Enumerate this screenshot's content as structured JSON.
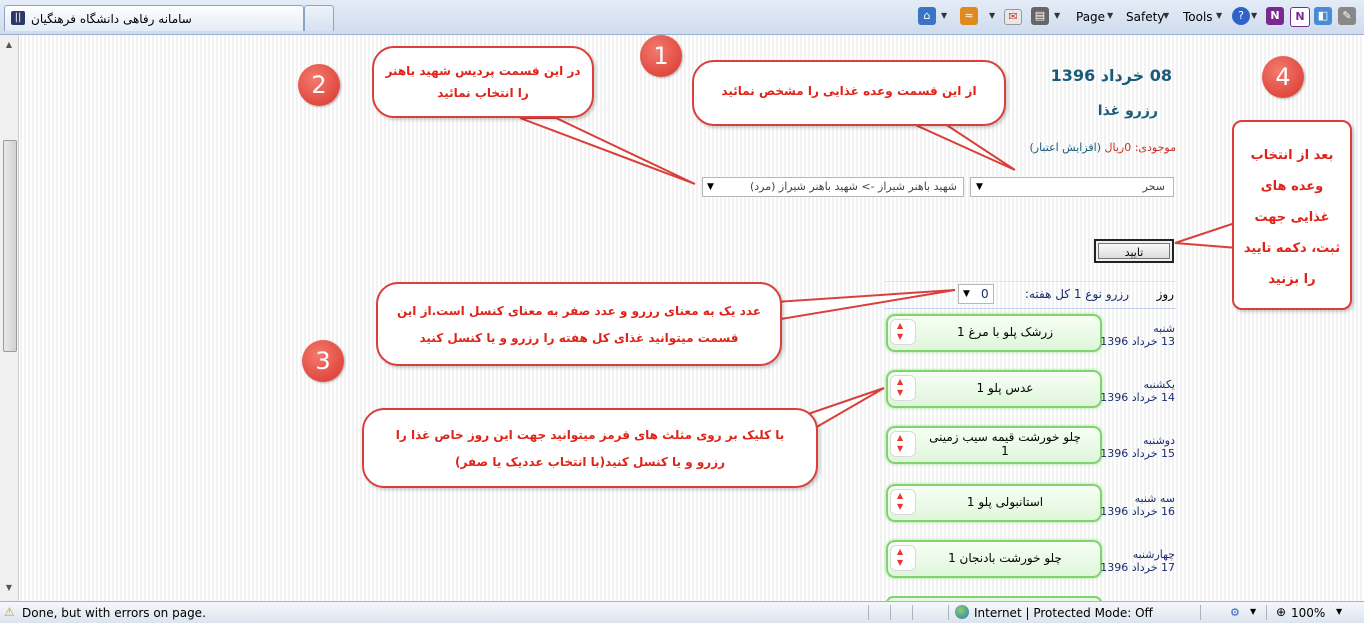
{
  "browser": {
    "tab_title": "سامانه رفاهی دانشگاه فرهنگیان",
    "toolbar": {
      "page": "Page",
      "safety": "Safety",
      "tools": "Tools"
    },
    "status": {
      "message": "Done, but with errors on page.",
      "zone": "Internet | Protected Mode: Off",
      "zoom": "100%"
    }
  },
  "page": {
    "date": "08 خرداد 1396",
    "title": "رزرو غذا",
    "balance_label": "موجودی:",
    "balance_value": "0ریال",
    "balance_link": "(افزایش اعتبار)",
    "meal_select": "سحر",
    "campus_select": "شهید باهنر شیراز -> شهید باهنر شیراز (مرد)",
    "confirm_button": "تایید",
    "day_header": "روز",
    "week_label": "رزرو نوع 1 کل هفته:",
    "week_value": "0",
    "days": [
      {
        "name": "شنبه",
        "date": "13 خرداد 1396",
        "food": "زرشک پلو با مرغ",
        "qty": "1"
      },
      {
        "name": "یکشنبه",
        "date": "14 خرداد 1396",
        "food": "عدس پلو",
        "qty": "1"
      },
      {
        "name": "دوشنبه",
        "date": "15 خرداد 1396",
        "food": "چلو خورشت قیمه سیب زمینی",
        "qty": "1"
      },
      {
        "name": "سه شنبه",
        "date": "16 خرداد 1396",
        "food": "استانبولی پلو",
        "qty": "1"
      },
      {
        "name": "چهارشنبه",
        "date": "17 خرداد 1396",
        "food": "چلو خورشت بادنجان",
        "qty": "1"
      }
    ]
  },
  "annotations": {
    "n1": "1",
    "n2": "2",
    "n3": "3",
    "n4": "4",
    "bubble_campus_1": "در این قسمت پردیس شهید باهنر",
    "bubble_campus_2": "را انتخاب نمائید",
    "bubble_meal": "از این قسمت وعده غذایی را مشخص نمائید",
    "bubble_week_1": "عدد یک به معنای رزرو و عدد صفر به معنای کنسل است.از این",
    "bubble_week_2": "قسمت میتوانید غذای کل هفته را رزرو و یا کنسل کنید",
    "bubble_day_1": "با کلیک بر روی مثلث های قرمز میتوانید جهت این روز خاص غذا را",
    "bubble_day_2": "رزرو و یا کنسل کنید(با انتخاب عددیک یا صفر)",
    "bubble_confirm_1": "بعد از انتخاب",
    "bubble_confirm_2": "وعده های",
    "bubble_confirm_3": "غذایی جهت",
    "bubble_confirm_4": "ثبت، دکمه تایید",
    "bubble_confirm_5": "را بزنید"
  },
  "colors": {
    "accent_red": "#d9403a",
    "title_teal": "#1a5a7a",
    "green_border": "#7fd46f"
  },
  "icons": [
    "home-icon",
    "feeds-icon",
    "mail-icon",
    "print-icon",
    "help-icon",
    "onenote-icon",
    "research-icon",
    "globe-icon",
    "zoom-icon"
  ]
}
